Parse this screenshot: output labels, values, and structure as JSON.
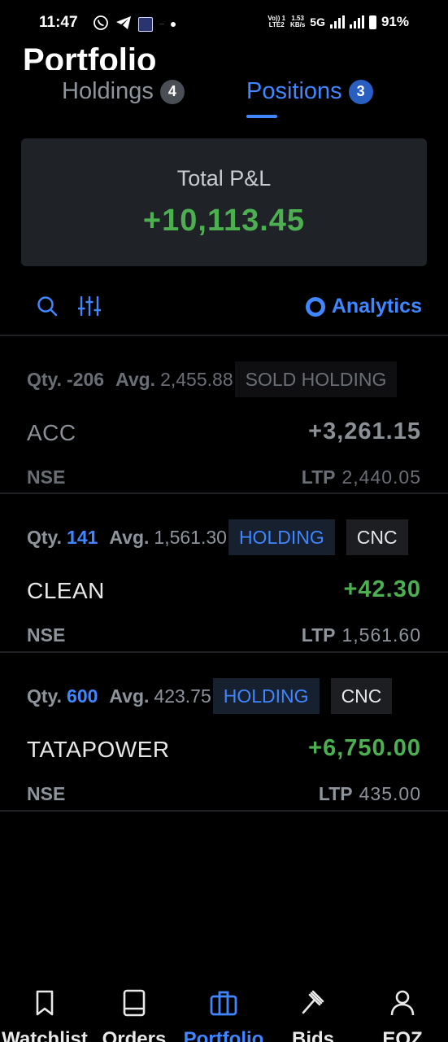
{
  "status_bar": {
    "time": "11:47",
    "volte_line1": "Vo)) 1",
    "volte_line2": "LTE2",
    "speed_value": "1.53",
    "speed_unit": "KB/s",
    "network": "5G",
    "battery": "91%",
    "icons": [
      "whatsapp-icon",
      "telegram-icon",
      "app-icon",
      "notification-icon",
      "dot-icon",
      "signal-icon",
      "battery-icon"
    ]
  },
  "header": {
    "title": "Portfolio"
  },
  "tabs": [
    {
      "label": "Holdings",
      "count": "4",
      "active": false
    },
    {
      "label": "Positions",
      "count": "3",
      "active": true
    }
  ],
  "pnl_card": {
    "label": "Total P&L",
    "value": "+10,113.45"
  },
  "toolbar": {
    "search_icon": "search-icon",
    "filter_icon": "filter-sliders-icon",
    "analytics_label": "Analytics"
  },
  "positions": [
    {
      "qty_label": "Qty.",
      "qty": "-206",
      "avg_label": "Avg.",
      "avg": "2,455.88",
      "tag": "SOLD HOLDING",
      "symbol": "ACC",
      "pnl": "+3,261.15",
      "exchange": "NSE",
      "ltp_label": "LTP",
      "ltp": "2,440.05"
    },
    {
      "qty_label": "Qty.",
      "qty": "141",
      "avg_label": "Avg.",
      "avg": "1,561.30",
      "tag": "HOLDING",
      "product": "CNC",
      "symbol": "CLEAN",
      "pnl": "+42.30",
      "exchange": "NSE",
      "ltp_label": "LTP",
      "ltp": "1,561.60"
    },
    {
      "qty_label": "Qty.",
      "qty": "600",
      "avg_label": "Avg.",
      "avg": "423.75",
      "tag": "HOLDING",
      "product": "CNC",
      "symbol": "TATAPOWER",
      "pnl": "+6,750.00",
      "exchange": "NSE",
      "ltp_label": "LTP",
      "ltp": "435.00"
    }
  ],
  "bottom_nav": [
    {
      "label": "Watchlist",
      "icon": "bookmark-icon"
    },
    {
      "label": "Orders",
      "icon": "book-icon"
    },
    {
      "label": "Portfolio",
      "icon": "briefcase-icon",
      "active": true
    },
    {
      "label": "Bids",
      "icon": "gavel-icon"
    },
    {
      "label": "EQZ",
      "icon": "user-icon"
    }
  ],
  "colors": {
    "accent": "#3f86ff",
    "profit": "#4caf50",
    "background": "#000000",
    "card": "#1f2227"
  }
}
